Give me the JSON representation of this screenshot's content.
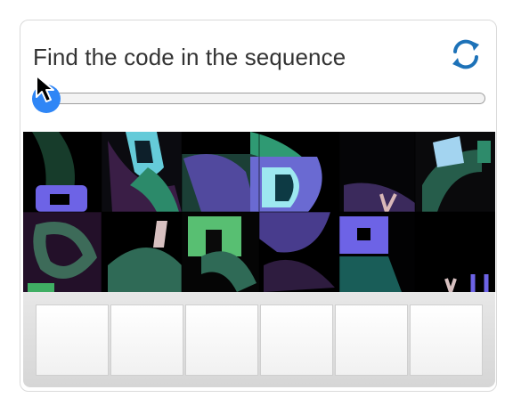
{
  "captcha": {
    "prompt": "Find the code in the sequence",
    "refresh_icon": "refresh-icon",
    "slider": {
      "value": 0
    },
    "code_slots": [
      "",
      "",
      "",
      "",
      "",
      ""
    ],
    "colors": {
      "accent": "#2f86f6",
      "refresh": "#1d72b8",
      "puzzle_bg": "#000000"
    }
  }
}
